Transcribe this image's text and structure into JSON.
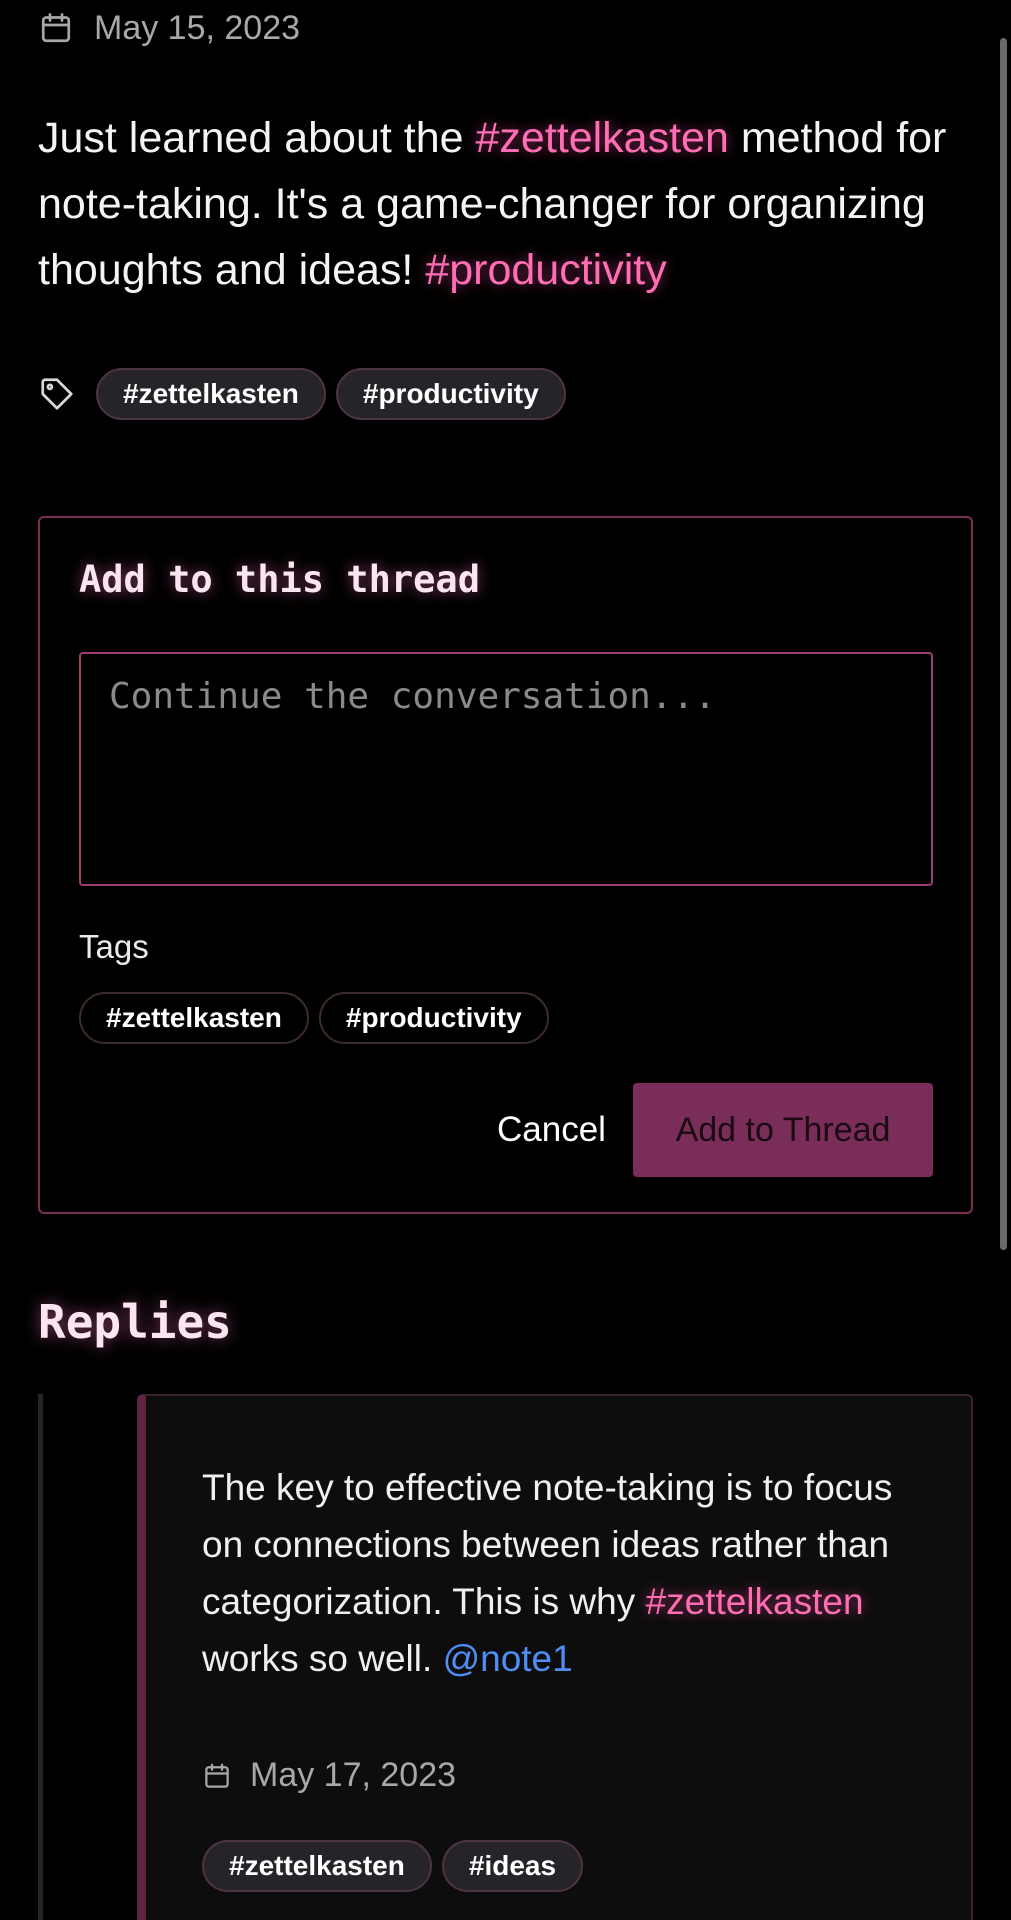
{
  "post": {
    "date": "May 15, 2023",
    "body": [
      {
        "type": "text",
        "value": "Just learned about the "
      },
      {
        "type": "hashtag",
        "value": "#zettelkasten"
      },
      {
        "type": "text",
        "value": " method for note-taking. It's a game-changer for organizing thoughts and ideas! "
      },
      {
        "type": "hashtag",
        "value": "#productivity"
      }
    ],
    "tags": [
      "#zettelkasten",
      "#productivity"
    ]
  },
  "composer": {
    "title": "Add to this thread",
    "placeholder": "Continue the conversation...",
    "value": "",
    "tags_label": "Tags",
    "tags": [
      "#zettelkasten",
      "#productivity"
    ],
    "cancel_label": "Cancel",
    "submit_label": "Add to Thread"
  },
  "replies": {
    "heading": "Replies",
    "items": [
      {
        "body": [
          {
            "type": "text",
            "value": "The key to effective note-taking is to focus on connections between ideas rather than categorization. This is why "
          },
          {
            "type": "hashtag",
            "value": "#zettelkasten"
          },
          {
            "type": "text",
            "value": " works so well. "
          },
          {
            "type": "mention",
            "value": "@note1"
          }
        ],
        "date": "May 17, 2023",
        "tags": [
          "#zettelkasten",
          "#ideas"
        ]
      }
    ]
  },
  "icons": {
    "date": "calendar-icon",
    "tags": "tag-icon"
  },
  "colors": {
    "background": "#000000",
    "hashtag": "#ff6eb4",
    "mention": "#4e8ef5",
    "accent": "#7a2d59",
    "border": "#7a2f58"
  }
}
